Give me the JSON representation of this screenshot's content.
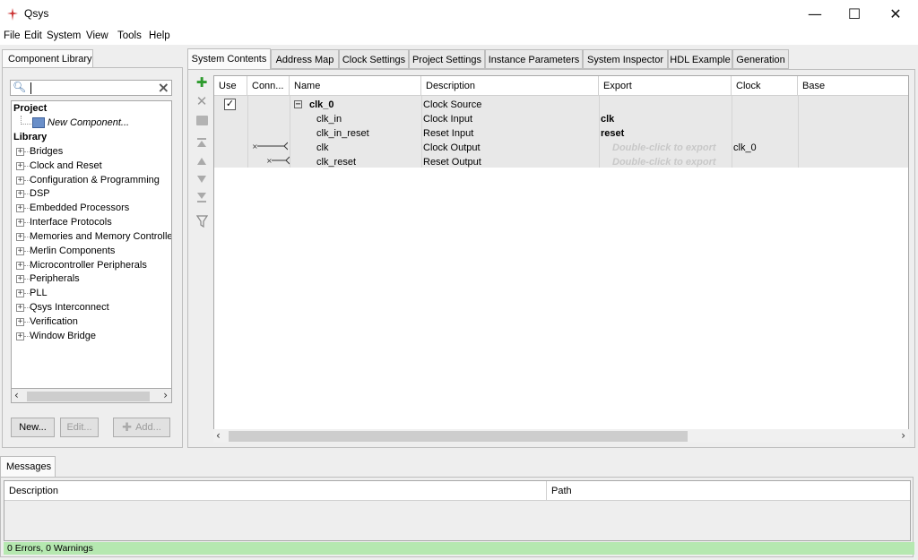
{
  "window": {
    "title": "Qsys",
    "minimize": "—",
    "maximize": "☐",
    "close": "✕"
  },
  "menu": [
    "File",
    "Edit",
    "System",
    "View",
    "Tools",
    "Help"
  ],
  "library": {
    "tab": "Component Library",
    "search_value": "",
    "project_header": "Project",
    "new_component": "New Component...",
    "library_header": "Library",
    "items": [
      "Bridges",
      "Clock and Reset",
      "Configuration & Programming",
      "DSP",
      "Embedded Processors",
      "Interface Protocols",
      "Memories and Memory Controllers",
      "Merlin Components",
      "Microcontroller Peripherals",
      "Peripherals",
      "PLL",
      "Qsys Interconnect",
      "Verification",
      "Window Bridge"
    ],
    "buttons": {
      "new": "New...",
      "edit": "Edit...",
      "add": "Add..."
    }
  },
  "tabs": [
    "System Contents",
    "Address Map",
    "Clock Settings",
    "Project Settings",
    "Instance Parameters",
    "System Inspector",
    "HDL Example",
    "Generation"
  ],
  "system_table": {
    "columns": [
      "Use",
      "Conn...",
      "Name",
      "Description",
      "Export",
      "Clock",
      "Base"
    ],
    "rows": [
      {
        "name": "clk_0",
        "description": "Clock Source",
        "export": "",
        "clock": ""
      },
      {
        "name": "clk_in",
        "description": "Clock Input",
        "export": "clk",
        "clock": ""
      },
      {
        "name": "clk_in_reset",
        "description": "Reset Input",
        "export": "reset",
        "clock": ""
      },
      {
        "name": "clk",
        "description": "Clock Output",
        "export": "Double-click to export",
        "clock": "clk_0"
      },
      {
        "name": "clk_reset",
        "description": "Reset Output",
        "export": "Double-click to export",
        "clock": ""
      }
    ]
  },
  "messages": {
    "tab": "Messages",
    "columns": [
      "Description",
      "Path"
    ],
    "status": "0 Errors, 0 Warnings"
  },
  "colors": {
    "status_bg": "#b5e8b0",
    "add_green": "#2e9b2e"
  }
}
